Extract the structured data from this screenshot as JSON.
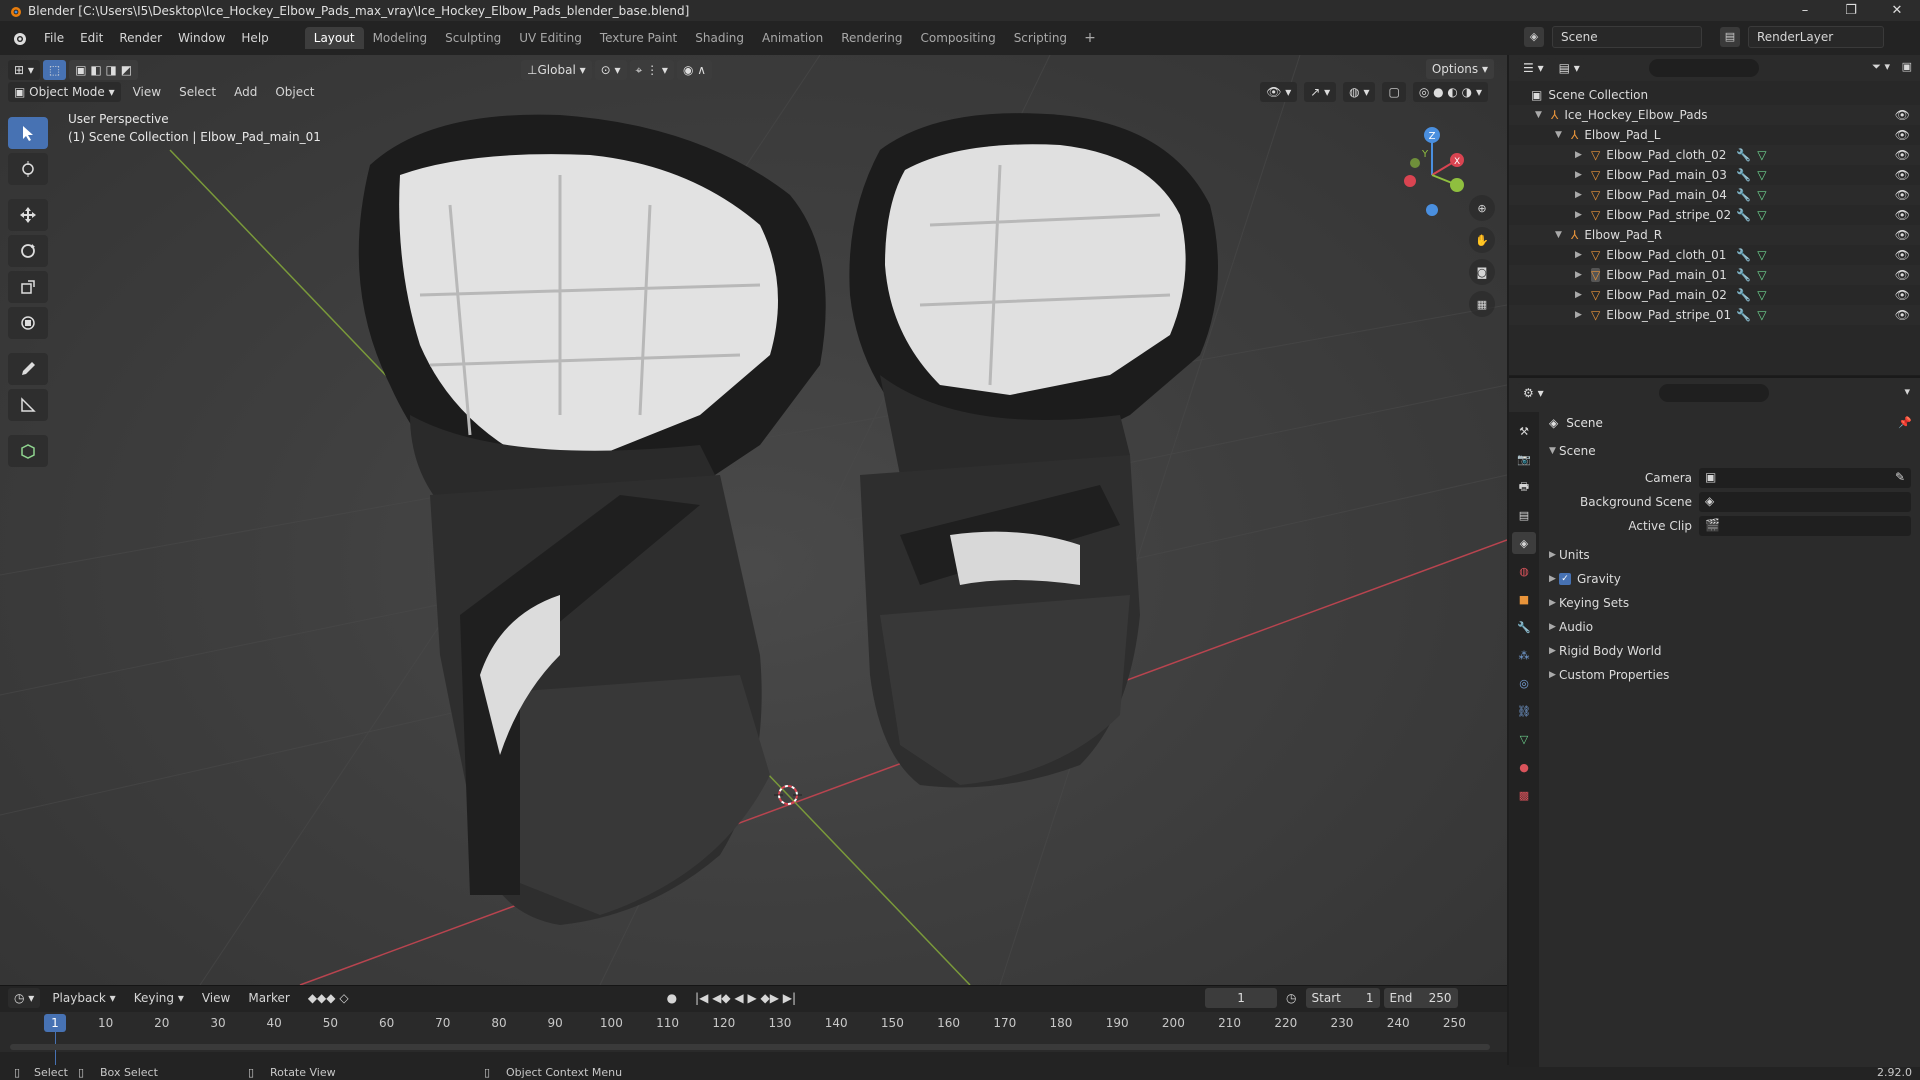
{
  "window": {
    "title": "Blender [C:\\Users\\I5\\Desktop\\Ice_Hockey_Elbow_Pads_max_vray\\Ice_Hockey_Elbow_Pads_blender_base.blend]",
    "controls": [
      "–",
      "❐",
      "✕"
    ]
  },
  "menubar": {
    "items": [
      "File",
      "Edit",
      "Render",
      "Window",
      "Help"
    ],
    "workspaces": [
      "Layout",
      "Modeling",
      "Sculpting",
      "UV Editing",
      "Texture Paint",
      "Shading",
      "Animation",
      "Rendering",
      "Compositing",
      "Scripting"
    ],
    "active_workspace": "Layout",
    "add_label": "+",
    "scene": "Scene",
    "render_layer": "RenderLayer"
  },
  "viewport": {
    "transform_orientation": "Global",
    "mode": "Object Mode",
    "menus": [
      "View",
      "Select",
      "Add",
      "Object"
    ],
    "options_label": "Options",
    "info_line1": "User Perspective",
    "info_line2": "(1) Scene Collection | Elbow_Pad_main_01",
    "axes": {
      "x": "X",
      "y": "Y",
      "z": "Z"
    }
  },
  "outliner": {
    "root": "Scene Collection",
    "collection": "Ice_Hockey_Elbow_Pads",
    "groups": [
      {
        "name": "Elbow_Pad_L",
        "children": [
          "Elbow_Pad_cloth_02",
          "Elbow_Pad_main_03",
          "Elbow_Pad_main_04",
          "Elbow_Pad_stripe_02"
        ]
      },
      {
        "name": "Elbow_Pad_R",
        "children": [
          "Elbow_Pad_cloth_01",
          "Elbow_Pad_main_01",
          "Elbow_Pad_main_02",
          "Elbow_Pad_stripe_01"
        ]
      }
    ]
  },
  "properties": {
    "context_title": "Scene",
    "panel_scene": "Scene",
    "fields": [
      {
        "label": "Camera"
      },
      {
        "label": "Background Scene"
      },
      {
        "label": "Active Clip"
      }
    ],
    "subpanels": [
      "Units",
      "Gravity",
      "Keying Sets",
      "Audio",
      "Rigid Body World",
      "Custom Properties"
    ],
    "gravity_checked": true
  },
  "timeline": {
    "menus": [
      "Playback",
      "Keying",
      "View",
      "Marker"
    ],
    "current_frame": "1",
    "start_label": "Start",
    "start_value": "1",
    "end_label": "End",
    "end_value": "250",
    "ruler_current": "1",
    "ticks": [
      "10",
      "20",
      "30",
      "40",
      "50",
      "60",
      "70",
      "80",
      "90",
      "100",
      "110",
      "120",
      "130",
      "140",
      "150",
      "160",
      "170",
      "180",
      "190",
      "200",
      "210",
      "220",
      "230",
      "240",
      "250"
    ]
  },
  "statusbar": {
    "select": "Select",
    "box_select": "Box Select",
    "rotate_view": "Rotate View",
    "context_menu": "Object Context Menu",
    "version": "2.92.0"
  },
  "colors": {
    "accent": "#4772b3",
    "x_axis": "#d94451",
    "y_axis": "#8fbf3f",
    "z_axis": "#4a8fdf",
    "object_orange": "#e8943a"
  }
}
